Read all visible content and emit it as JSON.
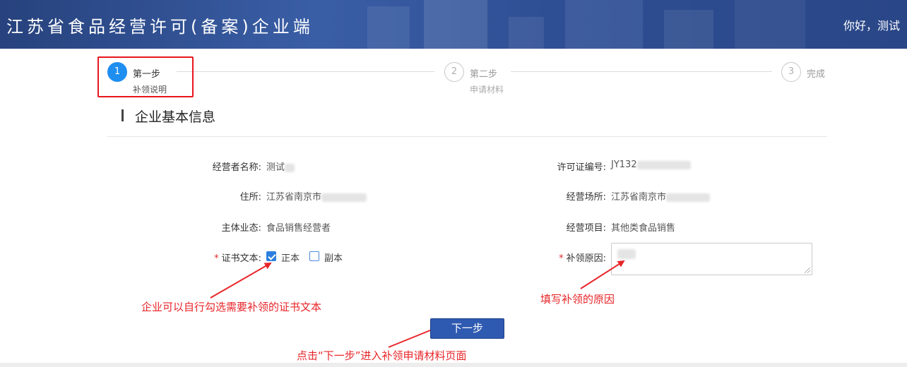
{
  "header": {
    "title": "江苏省食品经营许可(备案)企业端",
    "greeting": "你好，测试"
  },
  "steps": [
    {
      "number": "1",
      "title": "第一步",
      "desc": "补领说明",
      "active": true
    },
    {
      "number": "2",
      "title": "第二步",
      "desc": "申请材料",
      "active": false
    },
    {
      "number": "3",
      "title": "完成",
      "desc": "",
      "active": false
    }
  ],
  "section": {
    "title": "企业基本信息"
  },
  "fields": {
    "operator_name": {
      "label": "经营者名称:",
      "value": "测试"
    },
    "license_no": {
      "label": "许可证编号:",
      "value": "JY132"
    },
    "address": {
      "label": "住所:",
      "value": "江苏省南京市"
    },
    "business_place": {
      "label": "经营场所:",
      "value": "江苏省南京市"
    },
    "entity_type": {
      "label": "主体业态:",
      "value": "食品销售经营者"
    },
    "business_items": {
      "label": "经营项目:",
      "value": "其他类食品销售"
    },
    "cert_text": {
      "label": "证书文本:",
      "required_mark": "*",
      "options": [
        {
          "label": "正本",
          "checked": true
        },
        {
          "label": "副本",
          "checked": false
        }
      ]
    },
    "reissue_reason": {
      "label": "补领原因:",
      "required_mark": "*"
    }
  },
  "annotations": {
    "checkbox_hint": "企业可以自行勾选需要补领的证书文本",
    "reason_hint": "填写补领的原因",
    "next_hint": "点击“下一步”进入补领申请材料页面"
  },
  "buttons": {
    "next": "下一步"
  },
  "colors": {
    "header_bg": "#2f4f94",
    "active_step": "#1e8ef0",
    "annotation": "#e8262a",
    "button": "#2f5ab2"
  }
}
